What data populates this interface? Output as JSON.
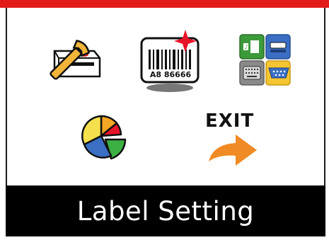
{
  "menu": {
    "items": [
      {
        "name": "setup",
        "icon": "wrench-printer-icon"
      },
      {
        "name": "label-setting",
        "icon": "barcode-label-icon",
        "barcode_text": "A8 86666"
      },
      {
        "name": "interface",
        "icon": "interface-ports-icon"
      },
      {
        "name": "statistics",
        "icon": "pie-chart-icon"
      },
      {
        "name": "exit",
        "icon": "exit-arrow-icon",
        "label": "EXIT"
      }
    ],
    "selected": "label-setting"
  },
  "status": {
    "title": "Label Setting"
  },
  "colors": {
    "top_bar": "#e41b1b",
    "status_bg": "#000000",
    "status_text": "#ffffff",
    "accent_orange": "#f08a24"
  }
}
